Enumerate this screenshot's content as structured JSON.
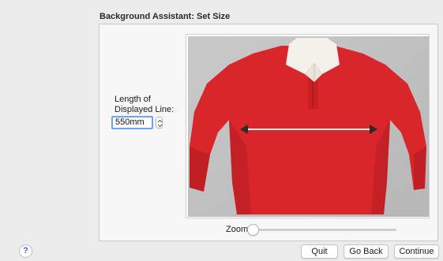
{
  "dialog": {
    "title": "Background Assistant: Set Size"
  },
  "length": {
    "label_line1": "Length of",
    "label_line2": "Displayed Line:",
    "value": "550mm"
  },
  "zoom": {
    "label": "Zoom:",
    "level": 0
  },
  "buttons": {
    "help": "?",
    "quit": "Quit",
    "go_back": "Go Back",
    "continue": "Continue"
  },
  "icons": {
    "stepper": "stepper-icon",
    "measure_line": "double-arrow-icon"
  },
  "colors": {
    "shirt": "#d8262b",
    "collar": "#f4f1ea",
    "focus": "#6fa6e8",
    "help": "#2d6fd6"
  }
}
